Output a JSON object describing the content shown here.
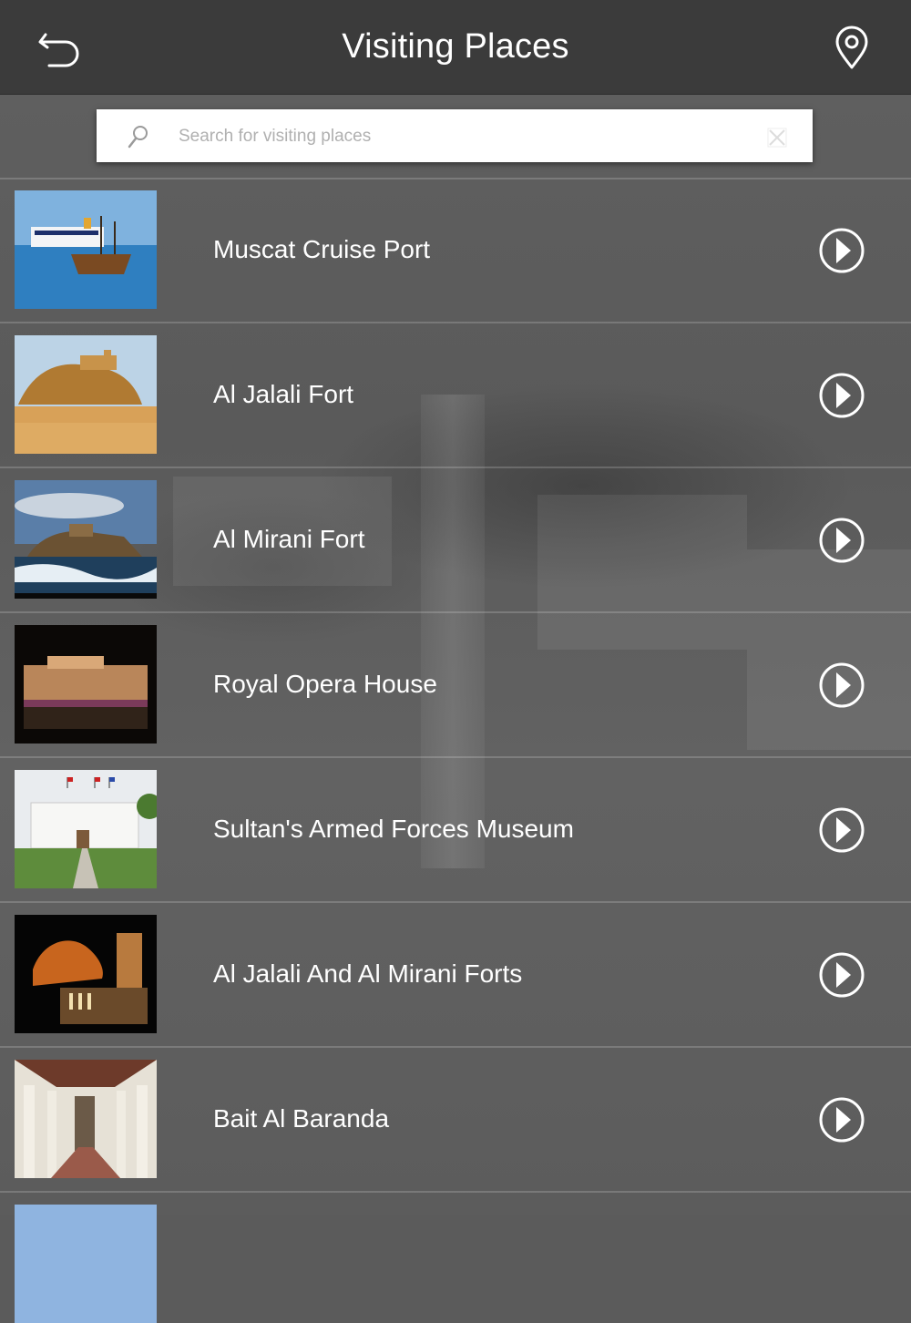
{
  "header": {
    "title": "Visiting Places",
    "back_icon": "back-arrow-icon",
    "location_icon": "map-pin-icon"
  },
  "search": {
    "placeholder": "Search for visiting places",
    "value": ""
  },
  "places": [
    {
      "name": "Muscat Cruise Port"
    },
    {
      "name": "Al Jalali Fort"
    },
    {
      "name": "Al Mirani Fort"
    },
    {
      "name": "Royal Opera House"
    },
    {
      "name": "Sultan's Armed Forces Museum"
    },
    {
      "name": "Al Jalali And Al Mirani Forts"
    },
    {
      "name": "Bait Al Baranda"
    }
  ],
  "colors": {
    "header_bg": "#3b3b3b",
    "list_bg": "#5b5b5b",
    "text": "#ffffff"
  }
}
